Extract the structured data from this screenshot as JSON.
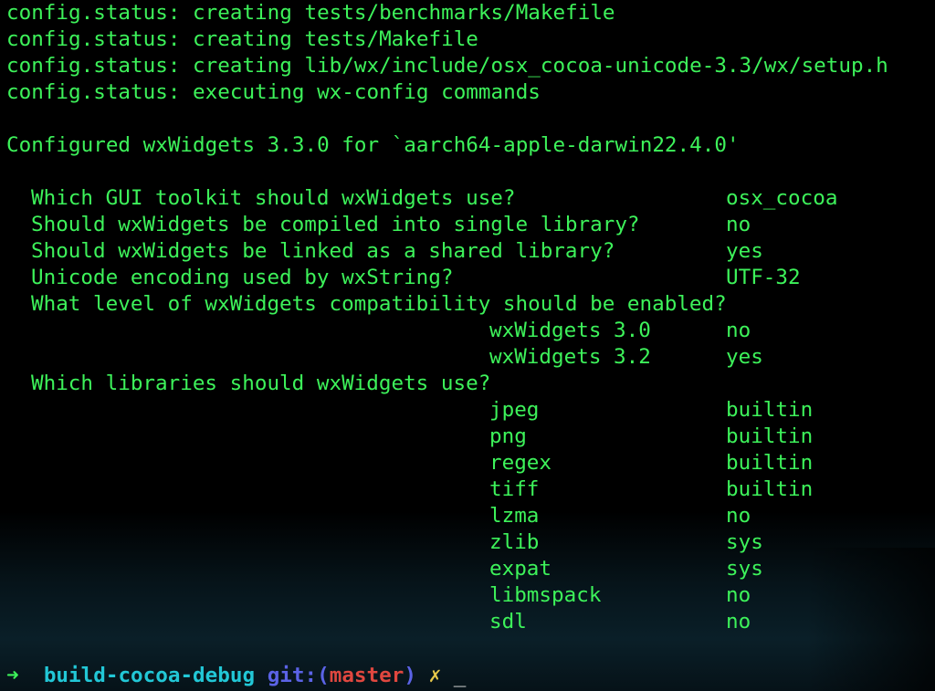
{
  "output": {
    "lines": [
      "config.status: creating tests/benchmarks/Makefile",
      "config.status: creating tests/Makefile",
      "config.status: creating lib/wx/include/osx_cocoa-unicode-3.3/wx/setup.h",
      "config.status: executing wx-config commands"
    ],
    "configured": "Configured wxWidgets 3.3.0 for `aarch64-apple-darwin22.4.0'",
    "questions": [
      {
        "q": "Which GUI toolkit should wxWidgets use?",
        "a": "osx_cocoa"
      },
      {
        "q": "Should wxWidgets be compiled into single library?",
        "a": "no"
      },
      {
        "q": "Should wxWidgets be linked as a shared library?",
        "a": "yes"
      },
      {
        "q": "Unicode encoding used by wxString?",
        "a": "UTF-32"
      }
    ],
    "compat_question": "What level of wxWidgets compatibility should be enabled?",
    "compat": [
      {
        "name": "wxWidgets 3.0",
        "value": "no"
      },
      {
        "name": "wxWidgets 3.2",
        "value": "yes"
      }
    ],
    "libs_question": "Which libraries should wxWidgets use?",
    "libs": [
      {
        "name": "jpeg",
        "value": "builtin"
      },
      {
        "name": "png",
        "value": "builtin"
      },
      {
        "name": "regex",
        "value": "builtin"
      },
      {
        "name": "tiff",
        "value": "builtin"
      },
      {
        "name": "lzma",
        "value": "no"
      },
      {
        "name": "zlib",
        "value": "sys"
      },
      {
        "name": "expat",
        "value": "sys"
      },
      {
        "name": "libmspack",
        "value": "no"
      },
      {
        "name": "sdl",
        "value": "no"
      }
    ]
  },
  "prompt": {
    "arrow": "➜",
    "directory": "build-cocoa-debug",
    "git_label": "git:",
    "paren_open": "(",
    "branch": "master",
    "paren_close": ")",
    "dirty_mark": "✗",
    "cursor": "_"
  },
  "colors": {
    "output_text": "#3df25a",
    "directory": "#22c7d6",
    "git": "#5b63e6",
    "branch": "#e0473f",
    "dirty": "#e6c84a"
  }
}
